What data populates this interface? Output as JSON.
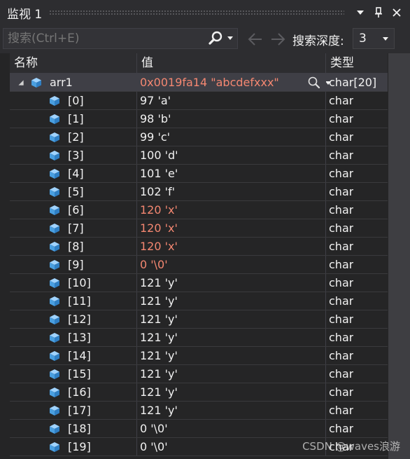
{
  "window": {
    "title": "监视 1",
    "pin_icon": "pin-icon",
    "dropdown_icon": "chevron-down-icon",
    "close_icon": "close-icon"
  },
  "toolbar": {
    "search_placeholder": "搜索(Ctrl+E)",
    "search_icon": "search-icon",
    "back_icon": "arrow-left-icon",
    "forward_icon": "arrow-right-icon",
    "depth_label": "搜索深度:",
    "depth_value": "3"
  },
  "columns": {
    "name": "名称",
    "value": "值",
    "type": "类型"
  },
  "colors": {
    "changed_value": "#f48771",
    "cube_icon": "#6cb4f0",
    "background": "#252526",
    "header_background": "#2d2d30"
  },
  "root": {
    "name": "arr1",
    "value": "0x0019fa14 \"abcdefxxx\"",
    "type": "char[20]",
    "changed": true,
    "expanded": true
  },
  "rows": [
    {
      "name": "[0]",
      "value": "97 'a'",
      "type": "char",
      "changed": false
    },
    {
      "name": "[1]",
      "value": "98 'b'",
      "type": "char",
      "changed": false
    },
    {
      "name": "[2]",
      "value": "99 'c'",
      "type": "char",
      "changed": false
    },
    {
      "name": "[3]",
      "value": "100 'd'",
      "type": "char",
      "changed": false
    },
    {
      "name": "[4]",
      "value": "101 'e'",
      "type": "char",
      "changed": false
    },
    {
      "name": "[5]",
      "value": "102 'f'",
      "type": "char",
      "changed": false
    },
    {
      "name": "[6]",
      "value": "120 'x'",
      "type": "char",
      "changed": true
    },
    {
      "name": "[7]",
      "value": "120 'x'",
      "type": "char",
      "changed": true
    },
    {
      "name": "[8]",
      "value": "120 'x'",
      "type": "char",
      "changed": true
    },
    {
      "name": "[9]",
      "value": "0 '\\0'",
      "type": "char",
      "changed": true
    },
    {
      "name": "[10]",
      "value": "121 'y'",
      "type": "char",
      "changed": false
    },
    {
      "name": "[11]",
      "value": "121 'y'",
      "type": "char",
      "changed": false
    },
    {
      "name": "[12]",
      "value": "121 'y'",
      "type": "char",
      "changed": false
    },
    {
      "name": "[13]",
      "value": "121 'y'",
      "type": "char",
      "changed": false
    },
    {
      "name": "[14]",
      "value": "121 'y'",
      "type": "char",
      "changed": false
    },
    {
      "name": "[15]",
      "value": "121 'y'",
      "type": "char",
      "changed": false
    },
    {
      "name": "[16]",
      "value": "121 'y'",
      "type": "char",
      "changed": false
    },
    {
      "name": "[17]",
      "value": "121 'y'",
      "type": "char",
      "changed": false
    },
    {
      "name": "[18]",
      "value": "0 '\\0'",
      "type": "char",
      "changed": false
    },
    {
      "name": "[19]",
      "value": "0 '\\0'",
      "type": "char",
      "changed": false
    }
  ],
  "watermark": "CSDN @waves浪游"
}
